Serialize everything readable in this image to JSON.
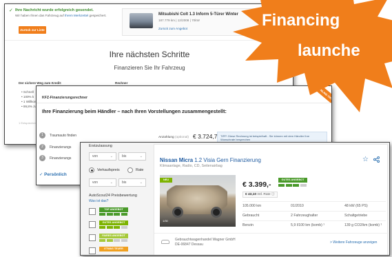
{
  "confirm": {
    "success_title": "Ihre Nachricht wurde erfolgreich gesendet.",
    "success_desc_prefix": "Wir haben Ihnen das Fahrzeug auf",
    "success_desc_link": "Ihrem Merkzettel",
    "success_desc_suffix": "gespeichert.",
    "back_button": "Zurück zur Liste",
    "vehicle_title": "Mitsubishi Colt 1.3 Inform 5-Türer Winter",
    "vehicle_sub": "187.779 km | 12/2008 | 70kW",
    "vehicle_link": "Zurück zum Angebot",
    "heading": "Ihre nächsten Schritte",
    "subheading": "Finanzieren Sie Ihr Fahrzeug",
    "col1_title": "Der sichere Weg zum Kredit:",
    "col2_title": "Rechner",
    "bullets": [
      "Schnell",
      "100% k",
      "1 Willkom",
      "99,8% zu"
    ],
    "footnote": "1 Entsprechen"
  },
  "calculator": {
    "title": "KFZ-Finanzierungsrechner",
    "subtitle": "Ihre Finanzierung beim Händler – nach Ihren Vorstellungen zusammengestellt:",
    "ribbon": "ONLINE-TIPP",
    "steps": [
      {
        "num": "1",
        "label": "Traumauto finden"
      },
      {
        "num": "2",
        "label": "Finanzierungs"
      },
      {
        "num": "3",
        "label": "Finanzierungs"
      }
    ],
    "down_payment_label": "Anzahlung",
    "down_payment_note": "(optional)",
    "amount": "€ 3.724,75",
    "tip": "TIPP: Diese Rechnung ist beispielhaft - Sie können mit dem Händler Ihre Wunschrate besprechen",
    "personal_link": "Persönlich"
  },
  "listing": {
    "filter": {
      "first_reg_label": "Erstzulassung",
      "from": "von",
      "to": "bis",
      "price_option": "Verkaufspreis",
      "rate_option": "Rate",
      "rating_label": "AutoScout24 Preisbewertung",
      "help_link": "Was ist das?",
      "badges": [
        {
          "label": "TOP ANGEBOT",
          "color": "#4a9a2a"
        },
        {
          "label": "GUTES ANGEBOT",
          "color": "#7db300"
        },
        {
          "label": "FAIRES ANGEBOT",
          "color": "#a6c93a"
        },
        {
          "label": "ETWAS TEUER",
          "color": "#f0a020"
        }
      ]
    },
    "car": {
      "make_model": "Nissan Micra",
      "variant": "1.2 Visia Gern Finanzierung",
      "features": "Klimaanlage, Radio, CD, Seitenairbag",
      "new_badge": "NEU",
      "photo_count": "1/30",
      "price": "€ 3.399,-",
      "price_badge": "GUTES ANGEBOT",
      "rate_prefix": "€ 43,10",
      "rate_suffix": "mtl. Rate",
      "specs": [
        [
          "105.000 km",
          "01/2010",
          "48 kW (65 PS)"
        ],
        [
          "Gebraucht",
          "2 Fahrzeughalter",
          "Schaltgetriebe"
        ],
        [
          "Benzin",
          "5,9 l/100 km (komb) ¹",
          "139 g CO2/km (komb) ¹"
        ]
      ],
      "dealer_name": "Gebrauchtwagenhandel Wagner GmbH",
      "dealer_location": "DE-06847 Dessau",
      "more_link": "> Weitere Fahrzeuge anzeigen"
    }
  },
  "overlay": {
    "line1": "Financing",
    "line2": "launche",
    "color": "#f07e1b"
  }
}
